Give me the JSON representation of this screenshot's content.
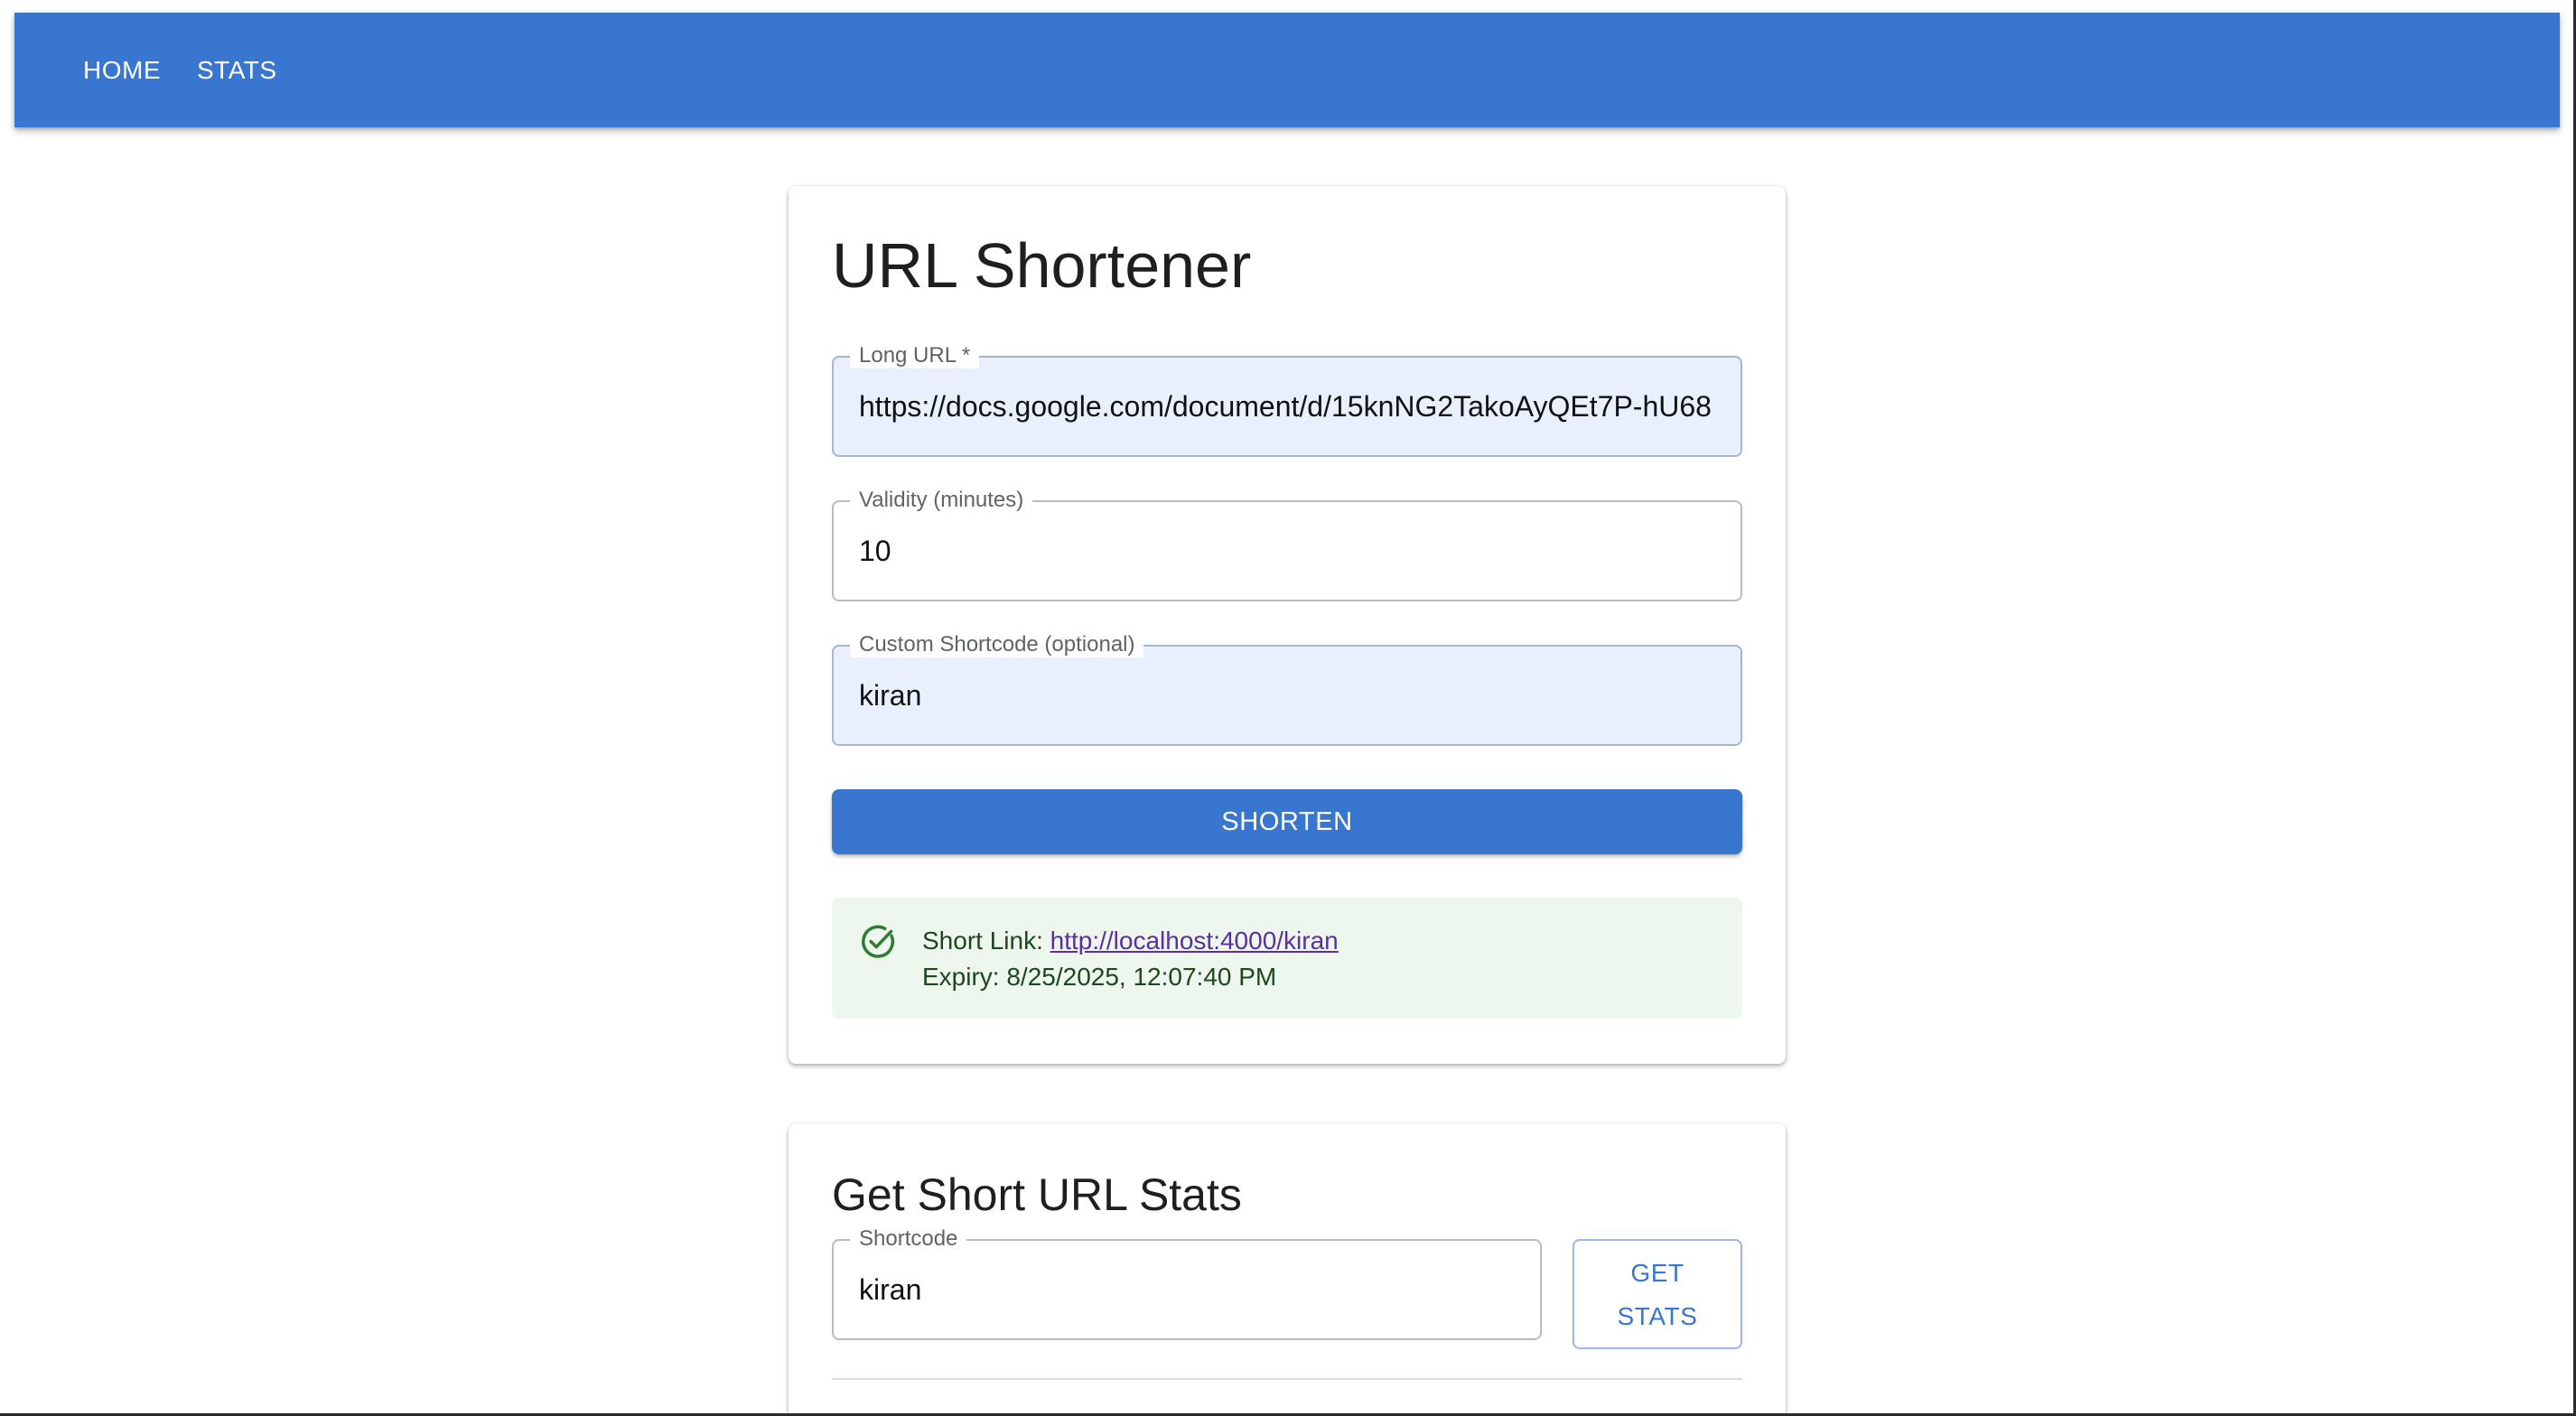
{
  "nav": {
    "items": [
      {
        "label": "HOME"
      },
      {
        "label": "STATS"
      }
    ]
  },
  "shortener": {
    "title": "URL Shortener",
    "long_url": {
      "label": "Long URL *",
      "value": "https://docs.google.com/document/d/15knNG2TakoAyQEt7P-hU68"
    },
    "validity": {
      "label": "Validity (minutes)",
      "value": "10"
    },
    "shortcode": {
      "label": "Custom Shortcode (optional)",
      "value": "kiran"
    },
    "submit_label": "SHORTEN",
    "result": {
      "icon": "check-circle-icon",
      "short_link_label": "Short Link:",
      "short_link": "http://localhost:4000/kiran",
      "expiry_label": "Expiry:",
      "expiry": "8/25/2025, 12:07:40 PM"
    }
  },
  "stats": {
    "title": "Get Short URL Stats",
    "shortcode": {
      "label": "Shortcode",
      "value": "kiran"
    },
    "button_line1": "GET",
    "button_line2": "STATS"
  },
  "colors": {
    "primary": "#3876cf",
    "autofill_bg": "#e8f0fe",
    "success_bg": "#edf7ed",
    "success_icon": "#2e7d32",
    "link": "#5b2fa0"
  }
}
